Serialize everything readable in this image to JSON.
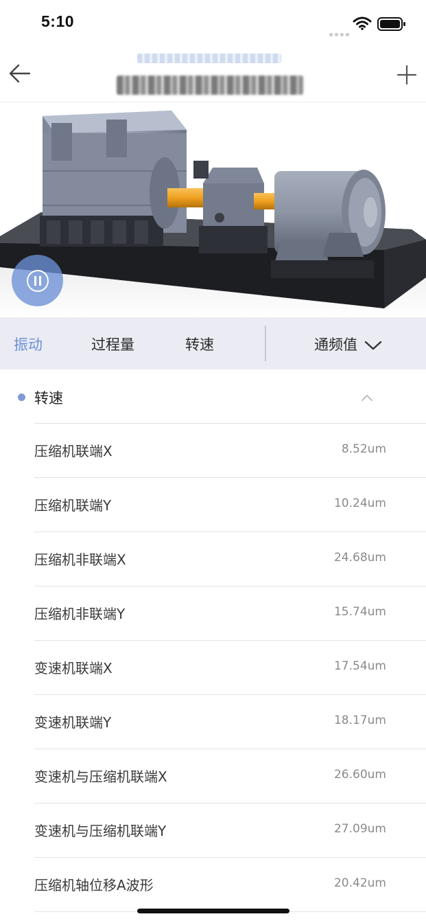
{
  "status_bar": {
    "time": "5:10"
  },
  "nav": {
    "back_icon": "arrow-left-icon",
    "add_icon": "plus-icon"
  },
  "tabs": [
    {
      "label": "振动",
      "active": true
    },
    {
      "label": "过程量",
      "active": false
    },
    {
      "label": "转速",
      "active": false
    }
  ],
  "dropdown": {
    "label": "通频值",
    "icon": "chevron-down-icon"
  },
  "section": {
    "title": "转速",
    "collapse_icon": "chevron-up-icon"
  },
  "rows": [
    {
      "label": "压缩机联端X",
      "value": "8.52um"
    },
    {
      "label": "压缩机联端Y",
      "value": "10.24um"
    },
    {
      "label": "压缩机非联端X",
      "value": "24.68um"
    },
    {
      "label": "压缩机非联端Y",
      "value": "15.74um"
    },
    {
      "label": "变速机联端X",
      "value": "17.54um"
    },
    {
      "label": "变速机联端Y",
      "value": "18.17um"
    },
    {
      "label": "变速机与压缩机联端X",
      "value": "26.60um"
    },
    {
      "label": "变速机与压缩机联端Y",
      "value": "27.09um"
    },
    {
      "label": "压缩机轴位移A波形",
      "value": "20.42um"
    }
  ],
  "colors": {
    "accent": "#6b8fd6",
    "tab_bar_bg": "#ebecf3",
    "coupling": "#f0a020",
    "machine": "#8e97a8"
  }
}
